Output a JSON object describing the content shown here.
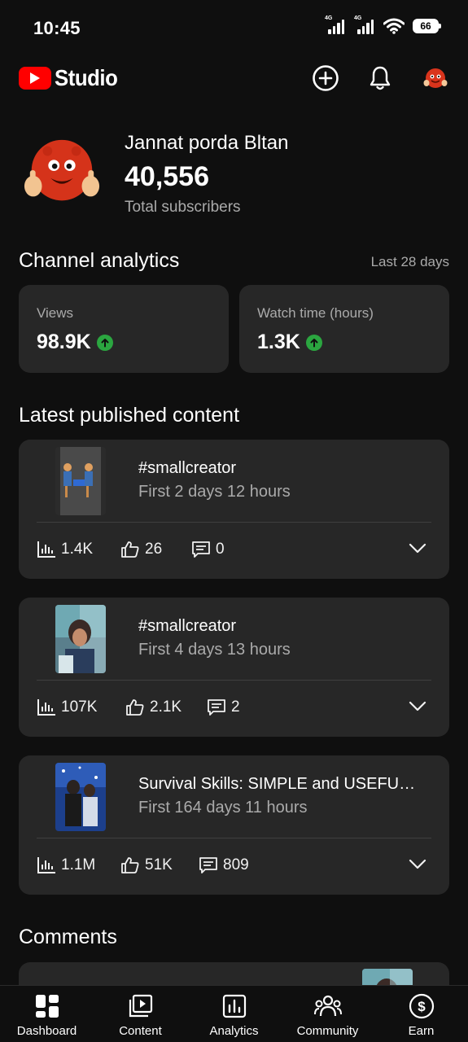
{
  "status_bar": {
    "time": "10:45",
    "network_1": "4G",
    "network_2": "4G",
    "battery": "66"
  },
  "header": {
    "logo_text": "Studio",
    "create_icon": "create-plus-icon",
    "notifications_icon": "bell-icon",
    "account_icon": "avatar"
  },
  "channel": {
    "name": "Jannat porda Bltan",
    "subscribers": "40,556",
    "subscribers_label": "Total subscribers"
  },
  "analytics": {
    "title": "Channel analytics",
    "range": "Last 28 days",
    "cards": [
      {
        "label": "Views",
        "value": "98.9K",
        "trend": "up"
      },
      {
        "label": "Watch time (hours)",
        "value": "1.3K",
        "trend": "up"
      }
    ]
  },
  "latest": {
    "title": "Latest published content",
    "items": [
      {
        "title": "#smallcreator",
        "subtitle": "First 2 days 12 hours",
        "views": "1.4K",
        "likes": "26",
        "comments": "0"
      },
      {
        "title": "#smallcreator",
        "subtitle": "First 4 days 13 hours",
        "views": "107K",
        "likes": "2.1K",
        "comments": "2"
      },
      {
        "title": "Survival Skills: SIMPLE and USEFUL …",
        "subtitle": "First 164 days 11 hours",
        "views": "1.1M",
        "likes": "51K",
        "comments": "809"
      }
    ]
  },
  "comments": {
    "title": "Comments"
  },
  "bottom_nav": {
    "items": [
      {
        "label": "Dashboard",
        "icon": "dashboard-icon"
      },
      {
        "label": "Content",
        "icon": "content-icon"
      },
      {
        "label": "Analytics",
        "icon": "analytics-icon"
      },
      {
        "label": "Community",
        "icon": "community-icon"
      },
      {
        "label": "Earn",
        "icon": "earn-icon"
      }
    ]
  },
  "colors": {
    "background": "#0f0f0f",
    "card": "#272727",
    "brand_red": "#ff0000",
    "trend_green": "#2ba640",
    "secondary_text": "#aaaaaa"
  }
}
